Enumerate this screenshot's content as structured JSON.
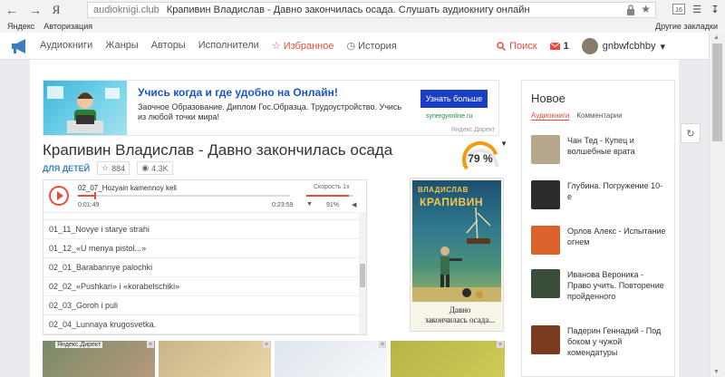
{
  "browser": {
    "yandex_logo": "Я",
    "domain": "audioknigi.club",
    "title": "Крапивин Владислав - Давно закончилась осада. Слушать аудиокнигу онлайн",
    "badge": "16"
  },
  "bookmarks": {
    "items": [
      "Яндекс",
      "Авторизация"
    ],
    "other": "Другие закладки"
  },
  "site_menu": {
    "items": [
      "Аудиокниги",
      "Жанры",
      "Авторы",
      "Исполнители"
    ],
    "favorites": "Избранное",
    "history": "История",
    "search": "Поиск",
    "messages_count": "1",
    "username": "gnbwfcbhby"
  },
  "ad": {
    "title": "Учись когда и где удобно на Онлайн!",
    "text": "Заочное Образование. Диплом Гос.Образца. Трудоустройство. Учись из любой точки мира!",
    "button": "Узнать больше",
    "source": "synergyonline.ru",
    "direct_label": "Яндекс.Директ"
  },
  "book": {
    "title": "Крапивин Владислав - Давно закончилась осада",
    "genre": "ДЛЯ ДЕТЕЙ",
    "favorites": "884",
    "views": "4.3K",
    "rating": "79 %",
    "rating_fraction": 0.79
  },
  "player": {
    "track": "02_07_Hozyain kamennoy keli",
    "current_time": "0:01:49",
    "total_time": "0:23:59",
    "progress": 0.076,
    "speed_label": "Скорость 1x",
    "volume_pct": "91%",
    "volume": 0.91
  },
  "playlist": [
    "01_11_Novye i starye strahi",
    "01_12_«U menya pistol...»",
    "02_01_Barabannye palochki",
    "02_02_«Pushkari» i «korabelschiki»",
    "02_03_Goroh i puli",
    "02_04_Lunnaya krugosvetka."
  ],
  "cover": {
    "author_first": "ВЛАДИСЛАВ",
    "author_last": "КРАПИВИН",
    "title_line1": "Давно",
    "title_line2": "закончилась осада..."
  },
  "tiles": {
    "direct_label": "Яндекс.Директ"
  },
  "sidebar": {
    "title": "Новое",
    "tab_active": "Аудиокниги",
    "tab_other": "Комментарии",
    "items": [
      {
        "text": "Чан Тед - Купец и волшебные врата",
        "color": "#b8a78f"
      },
      {
        "text": "Глубина. Погружение 10-е",
        "color": "#2b2b2b"
      },
      {
        "text": "Орлов Алекс - Испытание огнем",
        "color": "#d9632a"
      },
      {
        "text": "Иванова Вероника - Право учить. Повторение пройденного",
        "color": "#3a4d3a"
      },
      {
        "text": "Падерин Геннадий - Под боком у чужой комендатуры",
        "color": "#7a3b20"
      }
    ]
  },
  "colors": {
    "accent": "#e74c3c",
    "link": "#3b7fc1",
    "ad_button": "#1a3fc5"
  }
}
